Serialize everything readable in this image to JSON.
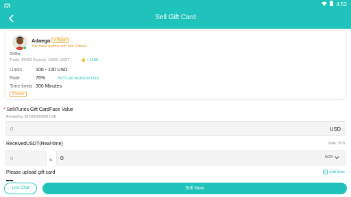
{
  "status_bar": {
    "time": "4:52"
  },
  "header": {
    "title": "Sell Gift Card"
  },
  "seller": {
    "name": "Adaego",
    "badge": "Buyer",
    "online_label": "Online",
    "traded_text": "You have traded with him 0 times",
    "trade_info": "Trade: 59403   Deposit: 10000 USDT",
    "trade_count": "+ 1199",
    "limits_label": "Limits",
    "limits_value": "100 - 100 USD",
    "rate_label": "Rate",
    "rate_value": "76%",
    "rate_detail": "35771.68 NGN/100 USD",
    "time_limits_label": "Time limits",
    "time_limits_value": "300 Minutes",
    "tag": "Pioneer"
  },
  "face_value": {
    "label": "SelliTunes Gift CardFace Value",
    "remaining": "Remaining: 907265/999999 USD",
    "value": "0",
    "unit": "USD"
  },
  "received": {
    "label": "ReceivedUSDT(Real-time)",
    "rate_text": "Rate: 76 %",
    "left_value": "0",
    "approx": "≈",
    "right_value": "0",
    "currency": "NGN"
  },
  "upload": {
    "label": "Please upload gift card",
    "add_note": "Add Note"
  },
  "footer": {
    "live_chat": "Live Chat",
    "sell_now": "Sell Now"
  },
  "colors": {
    "accent": "#1fc3bc",
    "warning": "#e39a2c"
  }
}
